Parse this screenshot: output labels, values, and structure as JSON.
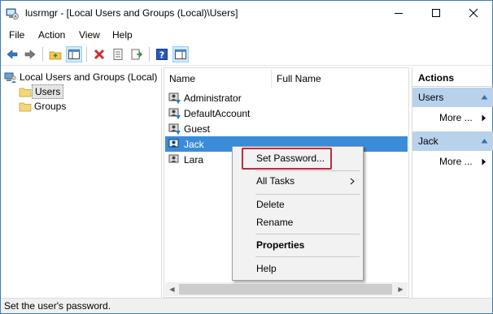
{
  "window": {
    "title": "lusrmgr - [Local Users and Groups (Local)\\Users]",
    "controls": {
      "minimize": "minimize",
      "maximize": "maximize",
      "close": "close"
    }
  },
  "menu": [
    "File",
    "Action",
    "View",
    "Help"
  ],
  "toolbar": {
    "buttons": [
      "back-icon",
      "forward-icon",
      "up-folder-icon",
      "show-hide-tree-icon",
      "delete-icon",
      "properties-icon",
      "export-icon",
      "help-icon",
      "show-hide-action-pane-icon"
    ]
  },
  "tree": {
    "root": "Local Users and Groups (Local)",
    "children": [
      "Users",
      "Groups"
    ],
    "selected": "Users"
  },
  "list": {
    "columns": [
      "Name",
      "Full Name"
    ],
    "rows": [
      {
        "name": "Administrator",
        "full_name": ""
      },
      {
        "name": "DefaultAccount",
        "full_name": ""
      },
      {
        "name": "Guest",
        "full_name": ""
      },
      {
        "name": "Jack",
        "full_name": ""
      },
      {
        "name": "Lara",
        "full_name": ""
      }
    ],
    "selected_row": "Jack"
  },
  "actions": {
    "header": "Actions",
    "sections": [
      {
        "title": "Users",
        "item": "More ..."
      },
      {
        "title": "Jack",
        "item": "More ..."
      }
    ]
  },
  "context_menu": {
    "items": [
      {
        "label": "Set Password...",
        "bold": false
      },
      {
        "label": "All Tasks",
        "bold": false,
        "submenu": true
      },
      {
        "label": "Delete",
        "bold": false
      },
      {
        "label": "Rename",
        "bold": false
      },
      {
        "label": "Properties",
        "bold": true
      },
      {
        "label": "Help",
        "bold": false
      }
    ],
    "highlight_color": "#b3313d"
  },
  "status": {
    "text": "Set the user's password."
  },
  "colors": {
    "selection": "#3a8cd9",
    "actions_section": "#b8d2ec",
    "window_border": "#3c7fb1"
  }
}
